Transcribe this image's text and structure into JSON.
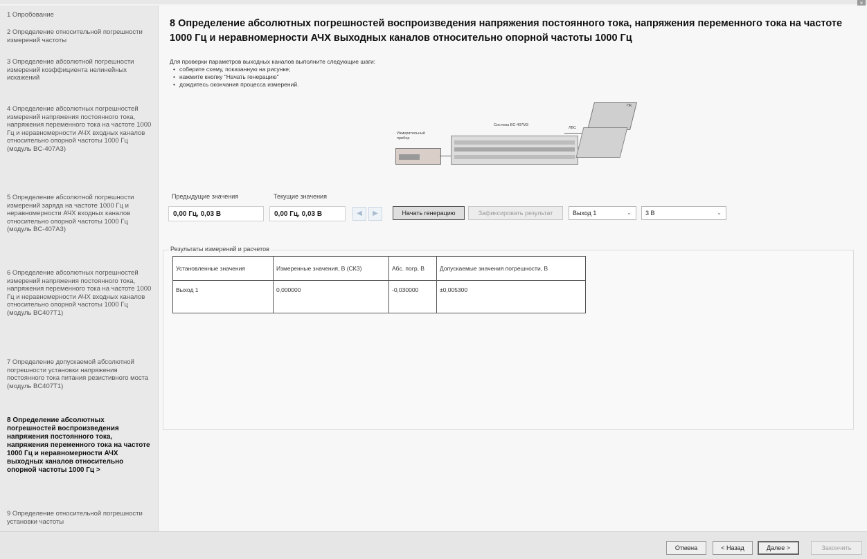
{
  "window": {
    "close_glyph": "×"
  },
  "sidebar": {
    "items": [
      {
        "label": "1 Опробование",
        "active": false
      },
      {
        "label": "2 Определение относительной погрешности измерений частоты",
        "active": false
      },
      {
        "label": "3 Определение абсолютной погрешности измерений коэффициента нелинейных искажений",
        "active": false
      },
      {
        "label": "4 Определение абсолютных погрешностей измерений напряжения постоянного тока, напряжения переменного тока на частоте 1000 Гц и неравномерности АЧХ входных каналов относительно опорной частоты 1000 Гц (модуль BC-407A3)",
        "active": false
      },
      {
        "label": "5 Определение абсолютной погрешности измерений заряда на частоте 1000 Гц и неравномерности АЧХ входных каналов относительно опорной частоты 1000 Гц (модуль BC-407A3)",
        "active": false
      },
      {
        "label": "6 Определение абсолютных погрешностей измерений напряжения постоянного тока, напряжения переменного тока на частоте 1000 Гц и неравномерности АЧХ входных каналов относительно опорной частоты 1000 Гц (модуль BC407T1)",
        "active": false
      },
      {
        "label": "7 Определение допускаемой абсолютной погрешности установки напряжения постоянного тока питания резистивного моста (модуль BC407T1)",
        "active": false
      },
      {
        "label": "8 Определение абсолютных погрешностей воспроизведения напряжения постоянного тока, напряжения переменного тока на частоте 1000 Гц и неравномерности АЧХ выходных каналов относительно опорной частоты 1000 Гц >",
        "active": true
      },
      {
        "label": "9 Определение относительной погрешности установки частоты",
        "active": false
      }
    ]
  },
  "main": {
    "title": "8 Определение абсолютных погрешностей воспроизведения напряжения постоянного тока, напряжения переменного тока на частоте 1000 Гц и неравномерности АЧХ выходных каналов относительно опорной частоты 1000 Гц",
    "instructions": {
      "intro": "Для проверки параметров выходных каналов выполните следующие шаги:",
      "steps": [
        "соберите схему, показанную на рисунке;",
        "нажмите кнопку \"Начать генерацию\"",
        "дождитесь окончания процесса измерений."
      ]
    },
    "diagram": {
      "meter_label": "Измерительный прибор",
      "system_label": "Система BC-407M3",
      "lan_label": "ЛВС",
      "pc_label": "ПК"
    },
    "values": {
      "previous_label": "Предыдущие значения",
      "previous_value": "0,00 Гц, 0,03 В",
      "current_label": "Текущие значения",
      "current_value": "0,00 Гц, 0,03 В"
    },
    "nav_buttons": {
      "prev_icon": "◀",
      "next_icon": "▶"
    },
    "buttons": {
      "start": "Начать генерацию",
      "record": "Зафиксировать результат"
    },
    "selects": {
      "output": "Выход 1",
      "voltage": "3 В"
    },
    "results": {
      "group_title": "Результаты измерений и расчетов",
      "headers": [
        "Установленные значения",
        "Измеренные значения, В (СКЗ)",
        "Абс. погр, В",
        "Допускаемые значения погрешности, В"
      ],
      "rows": [
        [
          "Выход 1",
          "0,000000",
          "-0,030000",
          "±0,005300"
        ]
      ]
    }
  },
  "footer": {
    "cancel": "Отмена",
    "back": "< Назад",
    "next": "Далее >",
    "finish": "Закончить"
  }
}
